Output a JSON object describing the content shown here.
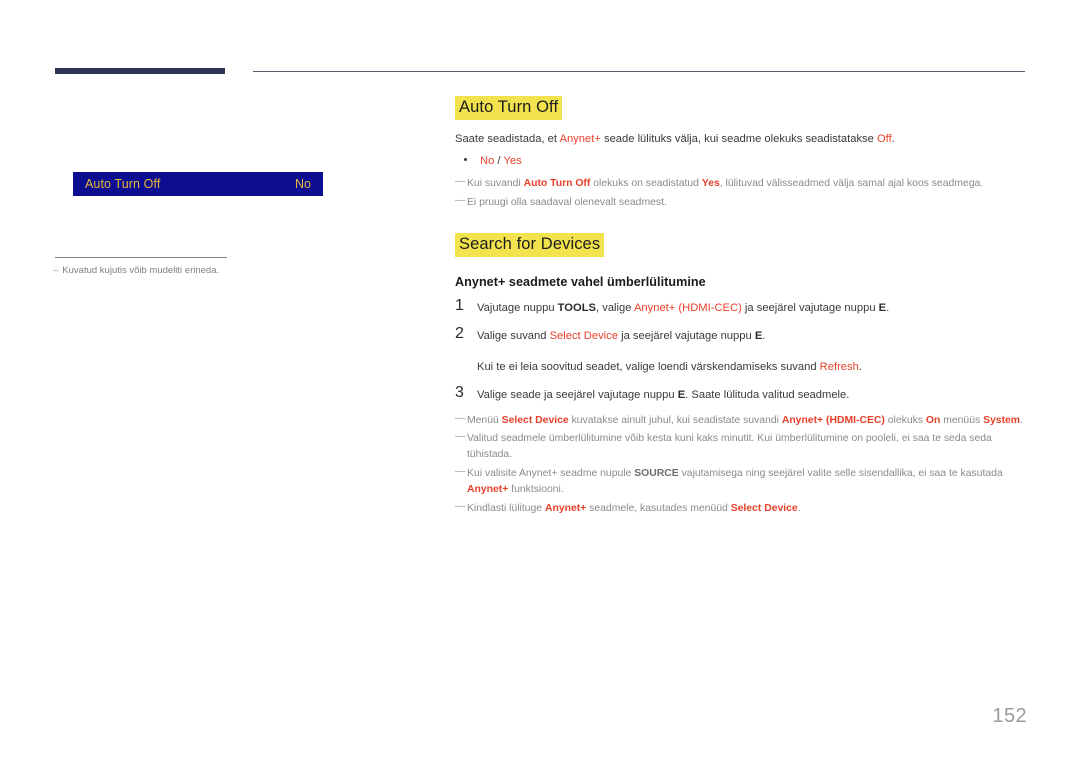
{
  "page": {
    "number": "152",
    "language": "Estonian"
  },
  "colors": {
    "accent": "#e8412a",
    "highlight": "#f2e24e",
    "osd_background": "#0d0d91",
    "osd_text": "#e8b63a",
    "header_bar": "#2e3455",
    "note_text": "#8a8a8a"
  },
  "left_column": {
    "osd": {
      "label": "Auto Turn Off",
      "value": "No"
    },
    "note": {
      "dash": "–",
      "text": "Kuvatud kujutis võib mudeliti erineda."
    }
  },
  "sections": [
    {
      "heading": "Auto Turn Off",
      "paragraph": {
        "parts": [
          {
            "text": "Saate seadistada, et ",
            "style": "plain"
          },
          {
            "text": "Anynet+",
            "style": "accent"
          },
          {
            "text": " seade lülituks välja, kui seadme olekuks seadistatakse ",
            "style": "plain"
          },
          {
            "text": "Off",
            "style": "accent"
          },
          {
            "text": ".",
            "style": "plain"
          }
        ]
      },
      "bullet": {
        "parts": [
          {
            "text": "No",
            "style": "accent"
          },
          {
            "text": " / ",
            "style": "plain"
          },
          {
            "text": "Yes",
            "style": "accent"
          }
        ]
      },
      "notes": [
        {
          "dash": "—",
          "parts": [
            {
              "text": "Kui suvandi ",
              "style": "plain"
            },
            {
              "text": "Auto Turn Off",
              "style": "accent-b"
            },
            {
              "text": " olekuks on seadistatud ",
              "style": "plain"
            },
            {
              "text": "Yes",
              "style": "accent-b"
            },
            {
              "text": ", lülituvad välisseadmed välja samal ajal koos seadmega.",
              "style": "plain"
            }
          ]
        },
        {
          "dash": "—",
          "parts": [
            {
              "text": "Ei pruugi olla saadaval olenevalt seadmest.",
              "style": "plain"
            }
          ]
        }
      ]
    },
    {
      "heading": "Search for Devices",
      "subheading": "Anynet+ seadmete vahel ümberlülitumine",
      "steps": [
        {
          "number": "1",
          "parts": [
            {
              "text": "Vajutage nuppu ",
              "style": "plain"
            },
            {
              "text": "TOOLS",
              "style": "dark-b"
            },
            {
              "text": ", valige ",
              "style": "plain"
            },
            {
              "text": "Anynet+ (HDMI-CEC)",
              "style": "accent"
            },
            {
              "text": " ja seejärel vajutage nuppu ",
              "style": "plain"
            },
            {
              "text": "E",
              "style": "dark-b"
            },
            {
              "text": ".",
              "style": "plain"
            }
          ]
        },
        {
          "number": "2",
          "parts": [
            {
              "text": "Valige suvand ",
              "style": "plain"
            },
            {
              "text": "Select Device",
              "style": "accent"
            },
            {
              "text": " ja seejärel vajutage nuppu ",
              "style": "plain"
            },
            {
              "text": "E",
              "style": "dark-b"
            },
            {
              "text": ".",
              "style": "plain"
            }
          ],
          "substep": {
            "parts": [
              {
                "text": "Kui te ei leia soovitud seadet, valige loendi värskendamiseks suvand ",
                "style": "plain"
              },
              {
                "text": "Refresh",
                "style": "accent"
              },
              {
                "text": ".",
                "style": "plain"
              }
            ]
          }
        },
        {
          "number": "3",
          "parts": [
            {
              "text": "Valige seade ja seejärel vajutage nuppu ",
              "style": "plain"
            },
            {
              "text": "E",
              "style": "dark-b"
            },
            {
              "text": ". Saate lülituda valitud seadmele.",
              "style": "plain"
            }
          ]
        }
      ],
      "notes": [
        {
          "dash": "—",
          "parts": [
            {
              "text": "Menüü ",
              "style": "plain"
            },
            {
              "text": "Select Device",
              "style": "accent-b"
            },
            {
              "text": " kuvatakse ainult juhul, kui seadistate suvandi ",
              "style": "plain"
            },
            {
              "text": "Anynet+ (HDMI-CEC)",
              "style": "accent-b"
            },
            {
              "text": " olekuks ",
              "style": "plain"
            },
            {
              "text": "On",
              "style": "accent-b"
            },
            {
              "text": " menüüs ",
              "style": "plain"
            },
            {
              "text": "System",
              "style": "accent-b"
            },
            {
              "text": ".",
              "style": "plain"
            }
          ]
        },
        {
          "dash": "—",
          "parts": [
            {
              "text": "Valitud seadmele ümberlülitumine võib kesta kuni kaks minutit. Kui ümberlülitumine on pooleli, ei saa te seda seda tühistada.",
              "style": "plain"
            }
          ]
        },
        {
          "dash": "—",
          "parts": [
            {
              "text": "Kui valisite Anynet+ seadme nupule ",
              "style": "plain"
            },
            {
              "text": "SOURCE",
              "style": "dark-b"
            },
            {
              "text": " vajutamisega ning seejärel valite selle sisendallika, ei saa te kasutada ",
              "style": "plain"
            },
            {
              "text": "Anynet+",
              "style": "accent-b"
            },
            {
              "text": " funktsiooni.",
              "style": "plain"
            }
          ]
        },
        {
          "dash": "—",
          "parts": [
            {
              "text": "Kindlasti lülituge ",
              "style": "plain"
            },
            {
              "text": "Anynet+",
              "style": "accent-b"
            },
            {
              "text": " seadmele, kasutades menüüd ",
              "style": "plain"
            },
            {
              "text": "Select Device",
              "style": "accent-b"
            },
            {
              "text": ".",
              "style": "plain"
            }
          ]
        }
      ]
    }
  ]
}
